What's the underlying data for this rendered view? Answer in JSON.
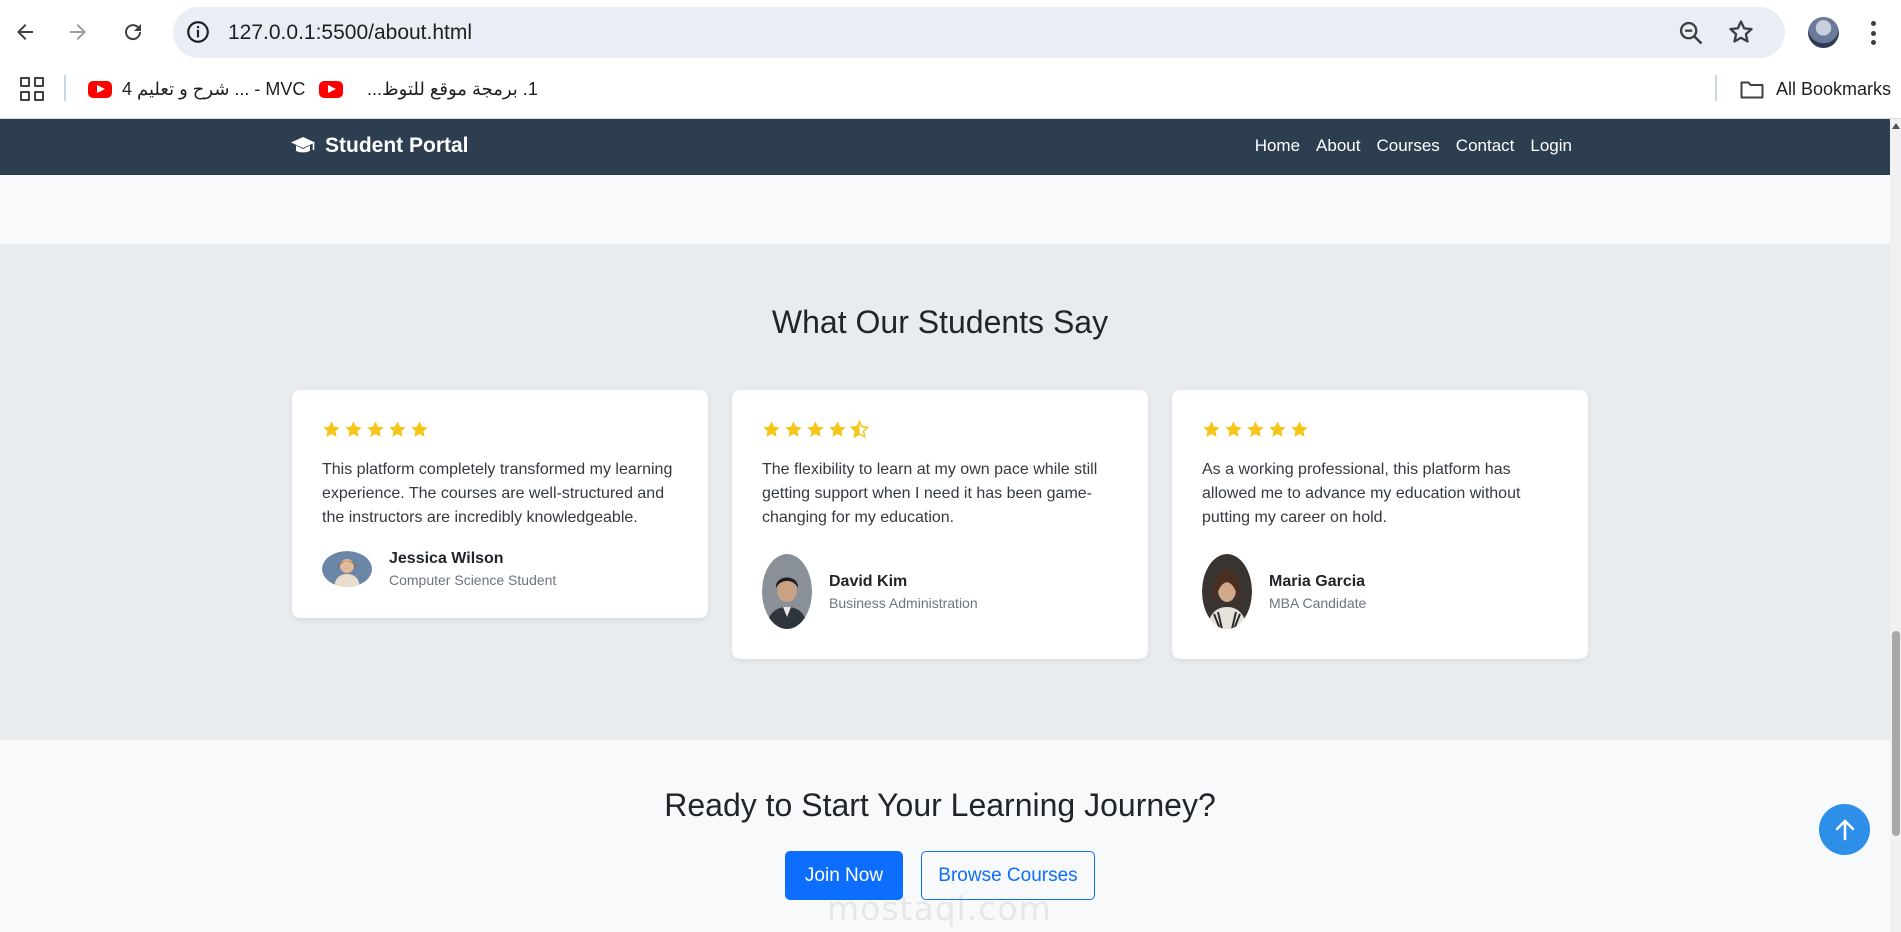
{
  "browser": {
    "url": "127.0.0.1:5500/about.html",
    "bookmarks": [
      {
        "label": "MVC - ... شرح و تعليم 4"
      },
      {
        "label": "1. برمجة موقع للتوظ..."
      }
    ],
    "all_bookmarks_label": "All Bookmarks"
  },
  "site": {
    "brand": "Student Portal",
    "nav": [
      "Home",
      "About",
      "Courses",
      "Contact",
      "Login"
    ]
  },
  "testimonials": {
    "title": "What Our Students Say",
    "items": [
      {
        "rating": 5,
        "quote": "This platform completely transformed my learning experience. The courses are well-structured and the instructors are incredibly knowledgeable.",
        "name": "Jessica Wilson",
        "role": "Computer Science Student"
      },
      {
        "rating": 4.5,
        "quote": "The flexibility to learn at my own pace while still getting support when I need it has been game-changing for my education.",
        "name": "David Kim",
        "role": "Business Administration"
      },
      {
        "rating": 5,
        "quote": "As a working professional, this platform has allowed me to advance my education without putting my career on hold.",
        "name": "Maria Garcia",
        "role": "MBA Candidate"
      }
    ]
  },
  "cta": {
    "title": "Ready to Start Your Learning Journey?",
    "primary": "Join Now",
    "secondary": "Browse Courses"
  },
  "watermark": "mostaql.com",
  "colors": {
    "navbar": "#2c3e50",
    "star": "#f5c518",
    "primary": "#0d6efd",
    "section_bg": "#e9ecef"
  },
  "icons": {
    "brand": "graduation-cap-icon",
    "back_to_top": "arrow-up-icon"
  }
}
